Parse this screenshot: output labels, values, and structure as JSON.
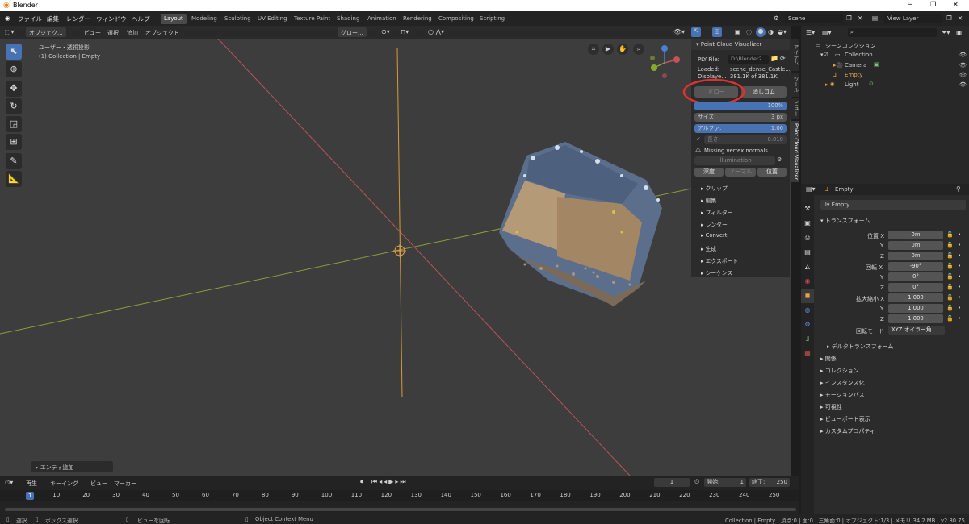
{
  "titlebar": {
    "title": "Blender",
    "minimize": "─",
    "maximize": "❐",
    "close": "✕"
  },
  "menu": [
    "ファイル",
    "編集",
    "レンダー",
    "ウィンドウ",
    "ヘルプ"
  ],
  "workspaces": [
    "Layout",
    "Modeling",
    "Sculpting",
    "UV Editing",
    "Texture Paint",
    "Shading",
    "Animation",
    "Rendering",
    "Compositing",
    "Scripting"
  ],
  "scene": {
    "name": "Scene",
    "view_layer": "View Layer"
  },
  "viewport_header": {
    "mode": "オブジェク...",
    "view": "ビュー",
    "select": "選択",
    "add": "追加",
    "object": "オブジェクト",
    "transform": "グロー..."
  },
  "viewport": {
    "view_name": "ユーザー・透視投影",
    "collection_info": "(1) Collection | Empty",
    "operator_panel": "エンティ追加"
  },
  "npanel": {
    "title": "Point Cloud Visualizer",
    "ply_label": "PLY File:",
    "ply_value": "D:\\Blender2.",
    "loaded_label": "Loaded:",
    "loaded_value": "scene_dense_Castle...",
    "display_label": "Displaye...",
    "display_value": "381.1K of 381.1K",
    "draw": "ドロー",
    "erase": "消しゴム",
    "percent": "100%",
    "size_label": "サイズ:",
    "size_value": "3 px",
    "alpha_label": "アルファ:",
    "alpha_value": "1.00",
    "length_label": "長さ:",
    "length_value": "0.010",
    "warning": "Missing vertex normals.",
    "illumination": "Illumination",
    "depth": "深度",
    "normal": "ノーマル",
    "position": "位置",
    "sections": [
      "クリップ",
      "編集",
      "フィルター",
      "レンダー",
      "Convert",
      "生成",
      "エクスポート",
      "シーケンス"
    ]
  },
  "sidetabs": [
    "アイテム",
    "ツール",
    "ビュー",
    "Point Cloud Visualizer"
  ],
  "outliner": {
    "scene_collection": "シーンコレクション",
    "items": [
      "Collection",
      "Camera",
      "Empty",
      "Light"
    ],
    "search_placeholder": ""
  },
  "properties": {
    "object_name": "Empty",
    "datablock": "Empty",
    "transform": "トランスフォーム",
    "location_label": "位置 X",
    "loc": [
      "0m",
      "0m",
      "0m"
    ],
    "rotation_label": "回転 X",
    "rot": [
      "-90°",
      "0°",
      "0°"
    ],
    "scale_label": "拡大縮小 X",
    "scale": [
      "1.000",
      "1.000",
      "1.000"
    ],
    "y": "Y",
    "z": "Z",
    "rotation_mode_label": "回転モード",
    "rotation_mode": "XYZ オイラー角",
    "delta": "デルタトランスフォーム",
    "sections": [
      "関係",
      "コレクション",
      "インスタンス化",
      "モーションパス",
      "可視性",
      "ビューポート表示",
      "カスタムプロパティ"
    ]
  },
  "timeline": {
    "play": "再生",
    "keying": "キーイング",
    "view": "ビュー",
    "marker": "マーカー",
    "current": "1",
    "start_label": "開始:",
    "start": "1",
    "end_label": "終了:",
    "end": "250",
    "ticks": [
      "1",
      "10",
      "20",
      "30",
      "40",
      "50",
      "60",
      "70",
      "80",
      "90",
      "100",
      "110",
      "120",
      "130",
      "140",
      "150",
      "160",
      "170",
      "180",
      "190",
      "200",
      "210",
      "220",
      "230",
      "240",
      "250"
    ]
  },
  "status": {
    "select": "選択",
    "box": "ボックス選択",
    "rotate": "ビューを回転",
    "context": "Object Context Menu",
    "stats": "Collection | Empty | 頂点:0 | 面:0 | 三角面:0 | オブジェクト:1/3 | メモリ:34.2 MB | v2.80.75"
  },
  "colors": {
    "accent": "#4772b3",
    "active_orange": "#e8a24a",
    "x_axis": "#c2535a",
    "y_axis": "#9bb33a",
    "z_axis": "#e3a23b",
    "annotation": "#e03030"
  }
}
